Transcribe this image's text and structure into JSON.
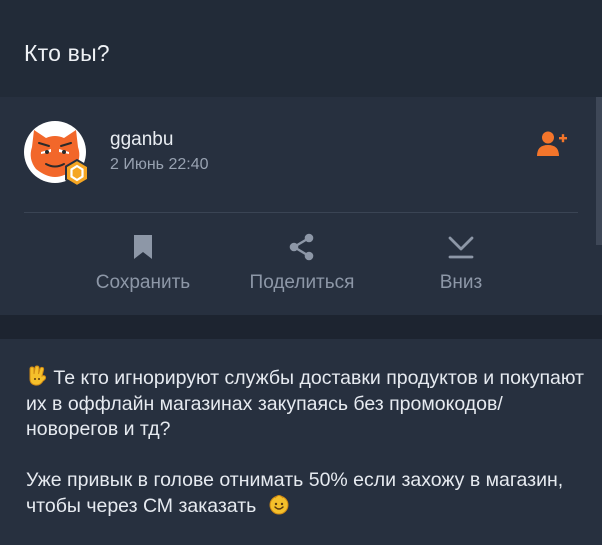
{
  "header": {
    "title": "Кто вы?"
  },
  "post": {
    "author": "gganbu",
    "date": "2 Июнь 22:40",
    "avatar_icon": "cat-avatar-icon",
    "badge_icon": "hexagon-badge-icon"
  },
  "actions": [
    {
      "label": "Сохранить",
      "icon": "bookmark-icon"
    },
    {
      "label": "Поделиться",
      "icon": "share-icon"
    },
    {
      "label": "Вниз",
      "icon": "chevron-down-bar-icon"
    }
  ],
  "content": {
    "paragraph1": "Те кто игнорируют службы доставки продуктов и покупают их в оффлайн магазинах закупаясь без промокодов/новорегов и тд?",
    "paragraph2": "Уже привык в голове отнимать 50% если захожу в магазин, чтобы через СМ заказать"
  },
  "colors": {
    "accent": "#f3752b",
    "background": "#27303f",
    "header": "#222b38",
    "text_muted": "#8d97a7"
  }
}
